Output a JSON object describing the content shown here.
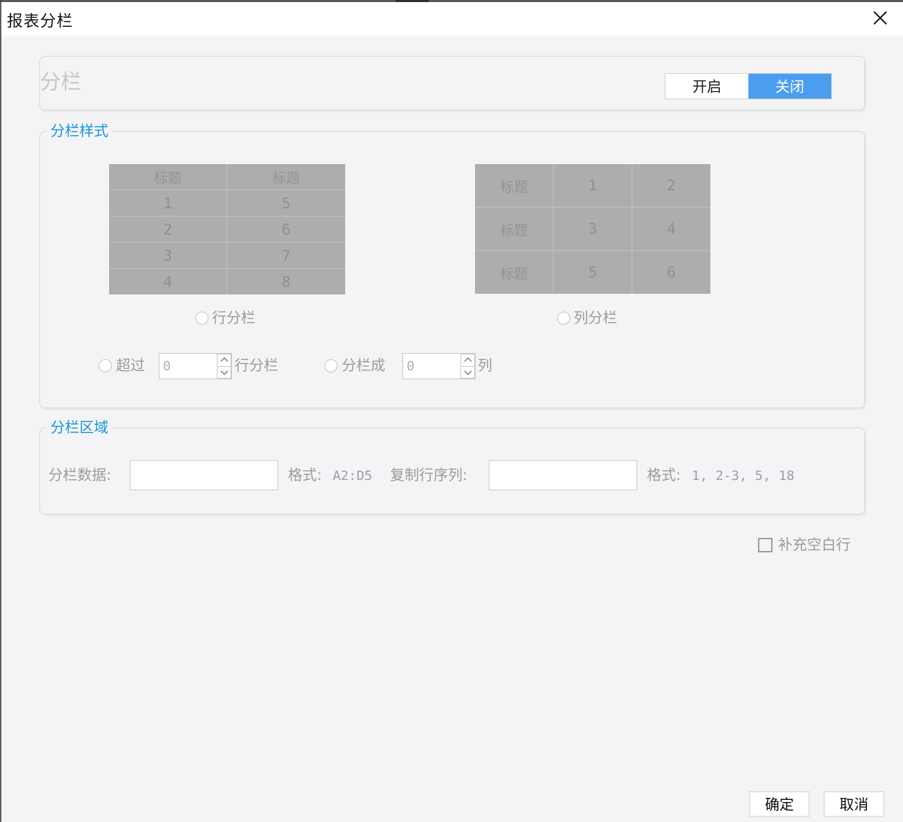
{
  "window": {
    "title": "报表分栏"
  },
  "toggle": {
    "section_label": "分栏",
    "on_label": "开启",
    "off_label": "关闭",
    "selected": "关闭"
  },
  "style_section": {
    "legend": "分栏样式",
    "row_table": {
      "headers": [
        "标题",
        "标题"
      ],
      "rows": [
        [
          "1",
          "5"
        ],
        [
          "2",
          "6"
        ],
        [
          "3",
          "7"
        ],
        [
          "4",
          "8"
        ]
      ]
    },
    "col_table": {
      "rows": [
        [
          "标题",
          "1",
          "2"
        ],
        [
          "标题",
          "3",
          "4"
        ],
        [
          "标题",
          "5",
          "6"
        ]
      ]
    },
    "row_split_label": "行分栏",
    "col_split_label": "列分栏",
    "over_prefix": "超过",
    "over_value": "0",
    "over_suffix": "行分栏",
    "into_prefix": "分栏成",
    "into_value": "0",
    "into_suffix": "列"
  },
  "area_section": {
    "legend": "分栏区域",
    "data_label": "分栏数据:",
    "data_value": "",
    "data_format_label": "格式:",
    "data_format_example": "A2:D5",
    "copy_label": "复制行序列:",
    "copy_value": "",
    "copy_format_label": "格式:",
    "copy_format_example": "1, 2-3, 5, 18"
  },
  "blank_row_checkbox": {
    "label": "补充空白行",
    "checked": false
  },
  "footer": {
    "ok_label": "确定",
    "cancel_label": "取消"
  },
  "colors": {
    "accent_blue": "#4b9eef",
    "legend_blue": "#1496db",
    "table_gray": "#adadad"
  }
}
